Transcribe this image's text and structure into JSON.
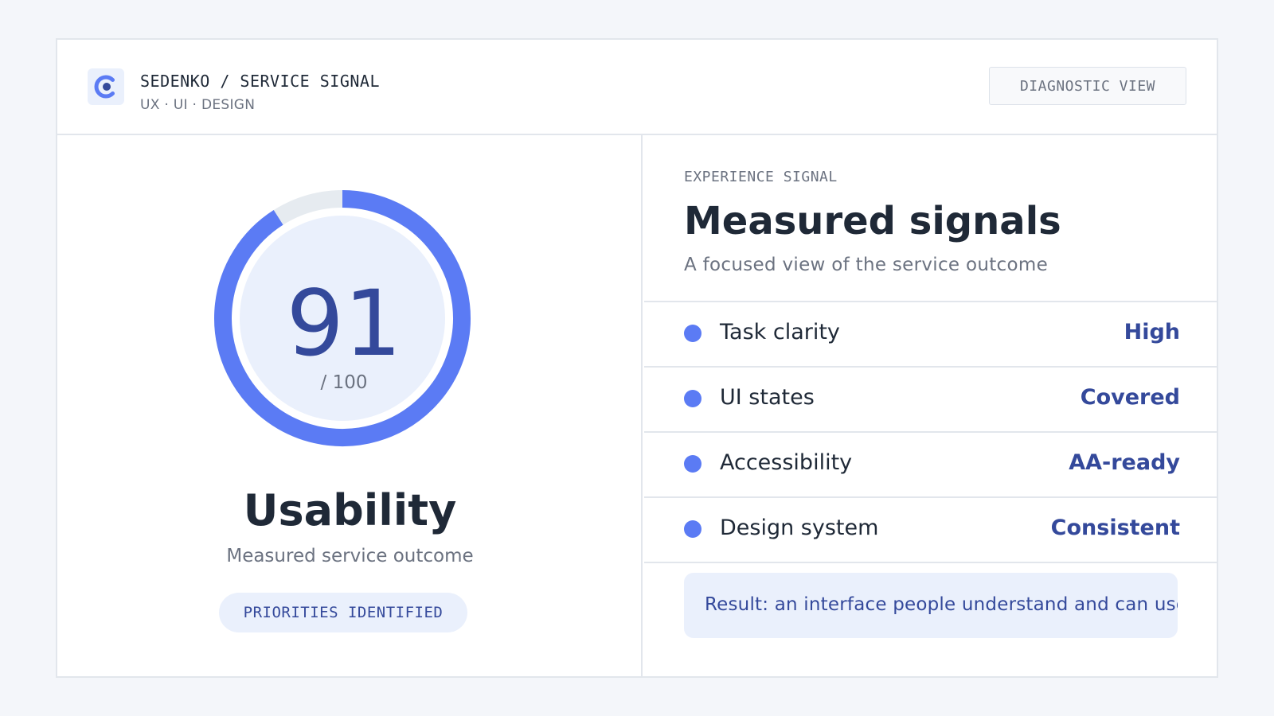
{
  "header": {
    "brand_title": "SEDENKO / SERVICE SIGNAL",
    "brand_subtitle": "UX · UI · DESIGN",
    "logo_icon": "c-logo-icon",
    "view_button": "DIAGNOSTIC VIEW"
  },
  "score": {
    "value": "91",
    "max_label": "/ 100",
    "gauge_fraction": 0.91,
    "metric": "Usability",
    "description": "Measured service outcome",
    "status_pill": "PRIORITIES IDENTIFIED"
  },
  "signals": {
    "eyebrow": "EXPERIENCE SIGNAL",
    "title": "Measured signals",
    "subtitle": "A focused view of the service outcome",
    "items": [
      {
        "label": "Task clarity",
        "value": "High"
      },
      {
        "label": "UI states",
        "value": "Covered"
      },
      {
        "label": "Accessibility",
        "value": "AA-ready"
      },
      {
        "label": "Design system",
        "value": "Consistent"
      }
    ],
    "result": "Result: an interface people understand and can use without"
  },
  "colors": {
    "accent": "#5b7bf4",
    "accent_dark": "#34499b",
    "soft_bg": "#eaf0fc",
    "track": "#e6ebf0",
    "page_bg": "#f4f6fa"
  }
}
